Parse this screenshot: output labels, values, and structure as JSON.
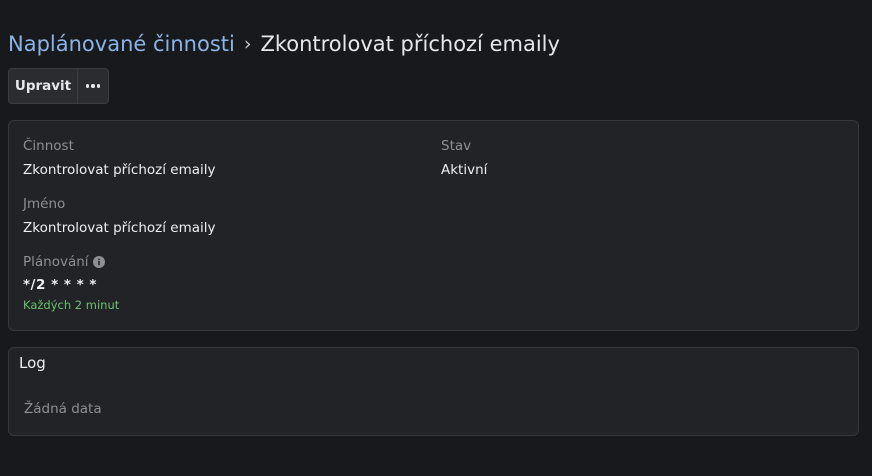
{
  "breadcrumb": {
    "parent": "Naplánované činnosti",
    "separator": "›",
    "current": "Zkontrolovat příchozí emaily"
  },
  "toolbar": {
    "edit_label": "Upravit",
    "more_icon": "more-horizontal-icon"
  },
  "details": {
    "activity_label": "Činnost",
    "activity_value": "Zkontrolovat příchozí emaily",
    "status_label": "Stav",
    "status_value": "Aktivní",
    "name_label": "Jméno",
    "name_value": "Zkontrolovat příchozí emaily",
    "schedule_label": "Plánování",
    "schedule_icon": "info-icon",
    "schedule_value": "*/2 * * * *",
    "schedule_hint": "Každých 2 minut",
    "schedule_hint_color": "#6cc070"
  },
  "log": {
    "title": "Log",
    "empty_text": "Žádná data"
  },
  "colors": {
    "background": "#18191c",
    "card": "#222327",
    "link": "#8ab4e8"
  }
}
